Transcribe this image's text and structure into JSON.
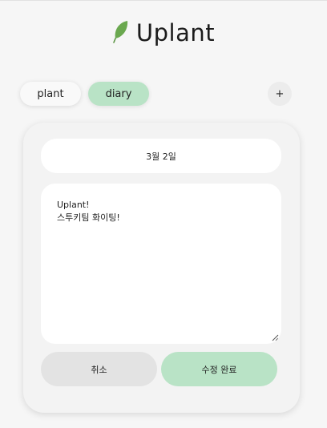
{
  "header": {
    "app_title": "Uplant",
    "logo_icon": "leaf-icon"
  },
  "tabs": [
    {
      "label": "plant",
      "active": false
    },
    {
      "label": "diary",
      "active": true
    }
  ],
  "add_button": {
    "label": "+"
  },
  "diary_form": {
    "date": "3월 2일",
    "content": "Uplant!\n스투키팀 화이팅!",
    "cancel_label": "취소",
    "submit_label": "수정 완료"
  },
  "colors": {
    "accent_green": "#b9e3c6",
    "leaf_green": "#6aa84f",
    "background": "#f6f6f6"
  }
}
